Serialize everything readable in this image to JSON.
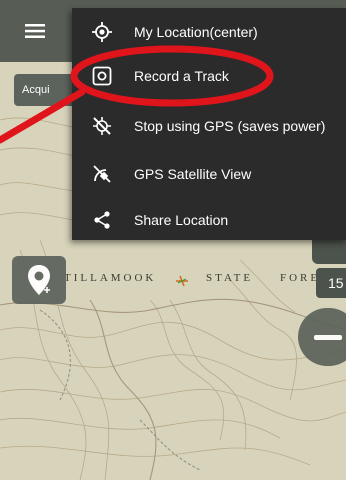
{
  "map": {
    "state_forest_label": "TILLAMOOK",
    "state_word": "STATE",
    "forest_word": "FORE",
    "acquire_chip": "Acqui",
    "zoom_level": "15"
  },
  "menu": {
    "items": [
      {
        "label": "My Location(center)",
        "icon": "crosshair-icon"
      },
      {
        "label": "Record a Track",
        "icon": "record-icon"
      },
      {
        "label": "Stop using GPS (saves power)",
        "icon": "gps-off-icon"
      },
      {
        "label": "GPS Satellite View",
        "icon": "satellite-icon"
      },
      {
        "label": "Share Location",
        "icon": "share-icon"
      }
    ]
  },
  "annotation": {
    "highlight_color": "#e0141b"
  },
  "colors": {
    "menu_bg": "#2b2b2b",
    "toolbar_bg": "#4c524c",
    "map_bg": "#d9d5bd"
  }
}
